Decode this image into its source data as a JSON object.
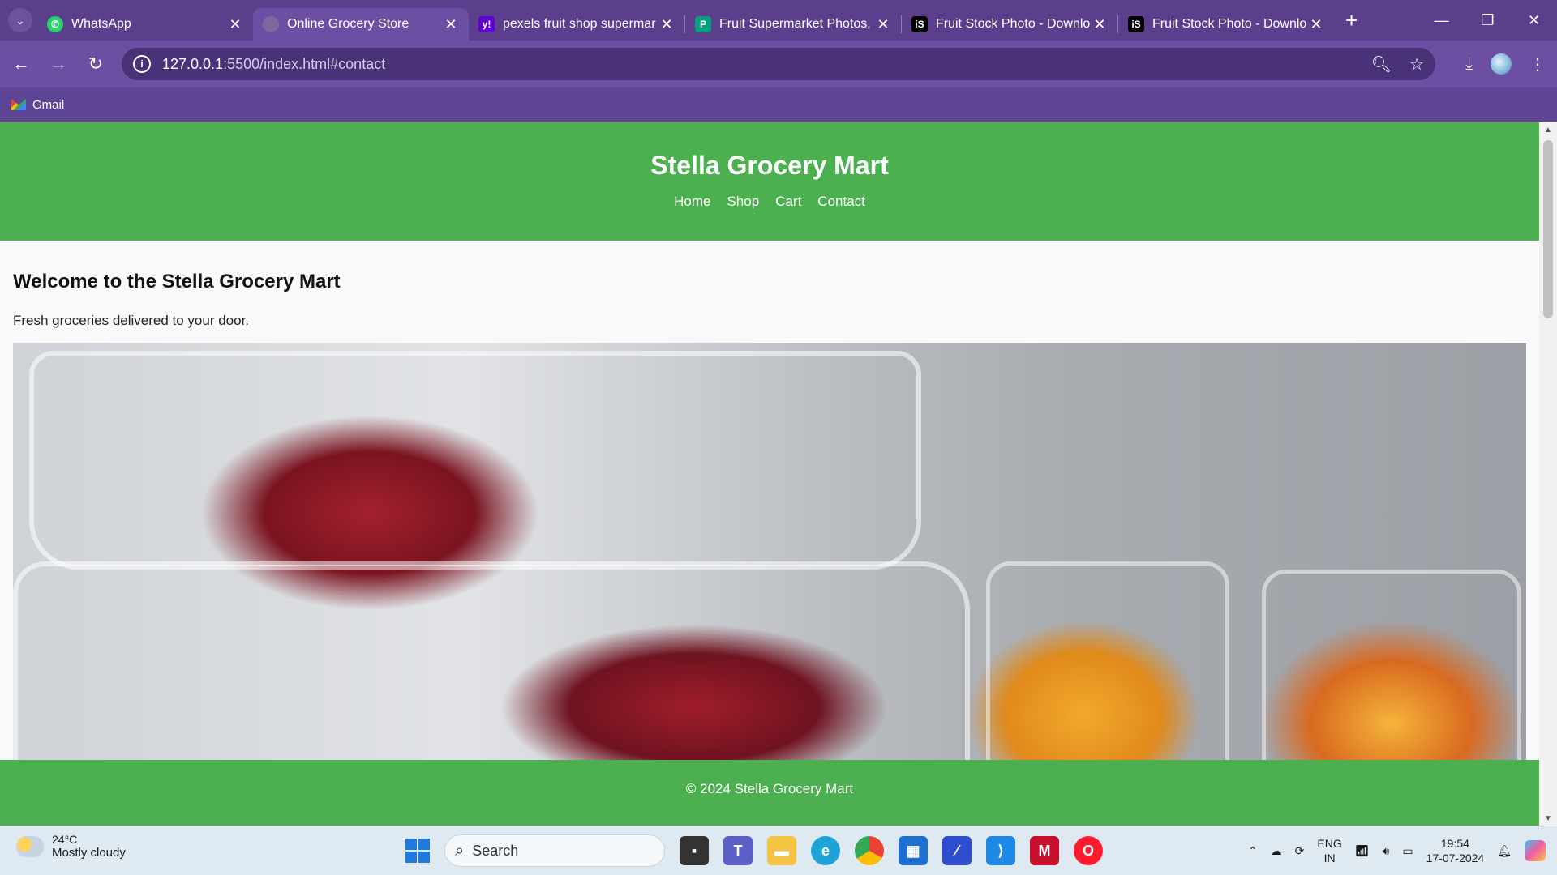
{
  "browser": {
    "tabs": [
      {
        "title": "WhatsApp",
        "favicon": "whatsapp-icon",
        "color": "#25d366",
        "active": false
      },
      {
        "title": "Online Grocery Store",
        "favicon": "globe-icon",
        "color": "#7a6a9c",
        "active": true
      },
      {
        "title": "pexels fruit shop supermar",
        "favicon": "yahoo-icon",
        "color": "#6001d2",
        "active": false
      },
      {
        "title": "Fruit Supermarket Photos, I",
        "favicon": "pexels-icon",
        "color": "#05a081",
        "active": false
      },
      {
        "title": "Fruit Stock Photo - Downlo",
        "favicon": "istock-icon",
        "color": "#000000",
        "active": false
      },
      {
        "title": "Fruit Stock Photo - Downlo",
        "favicon": "istock-icon",
        "color": "#000000",
        "active": false
      }
    ],
    "url_host": "127.0.0.1",
    "url_rest": ":5500/index.html#contact",
    "bookmarks": [
      {
        "label": "Gmail",
        "icon": "gmail-icon"
      }
    ]
  },
  "site": {
    "header_title": "Stella Grocery Mart",
    "nav": [
      "Home",
      "Shop",
      "Cart",
      "Contact"
    ],
    "welcome_heading": "Welcome to the Stella Grocery Mart",
    "tagline": "Fresh groceries delivered to your door.",
    "hero_image": "fruit-display-image",
    "footer": "© 2024 Stella Grocery Mart",
    "accent_color": "#4caf50"
  },
  "taskbar": {
    "weather_temp": "24°C",
    "weather_desc": "Mostly cloudy",
    "search_placeholder": "Search",
    "lang_line1": "ENG",
    "lang_line2": "IN",
    "time": "19:54",
    "date": "17-07-2024"
  }
}
